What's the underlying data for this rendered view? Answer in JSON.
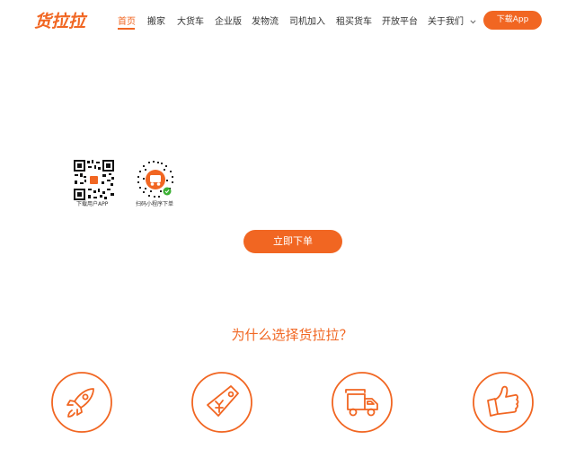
{
  "header": {
    "logo_text": "货拉拉",
    "nav": [
      {
        "label": "首页",
        "active": true
      },
      {
        "label": "搬家"
      },
      {
        "label": "大货车"
      },
      {
        "label": "企业版"
      },
      {
        "label": "发物流"
      },
      {
        "label": "司机加入"
      },
      {
        "label": "租买货车"
      },
      {
        "label": "开放平台"
      },
      {
        "label": "关于我们",
        "has_dropdown": true
      }
    ],
    "download_label": "下载App"
  },
  "qr_codes": [
    {
      "label": "下载用户APP"
    },
    {
      "label": "扫码小程序下单"
    }
  ],
  "cta_label": "立即下单",
  "why_section": {
    "title": "为什么选择货拉拉？",
    "features": [
      {
        "icon": "rocket-icon"
      },
      {
        "icon": "price-tag-icon"
      },
      {
        "icon": "truck-icon"
      },
      {
        "icon": "thumbs-up-icon"
      }
    ]
  },
  "colors": {
    "accent": "#f16622",
    "text": "#333333"
  }
}
